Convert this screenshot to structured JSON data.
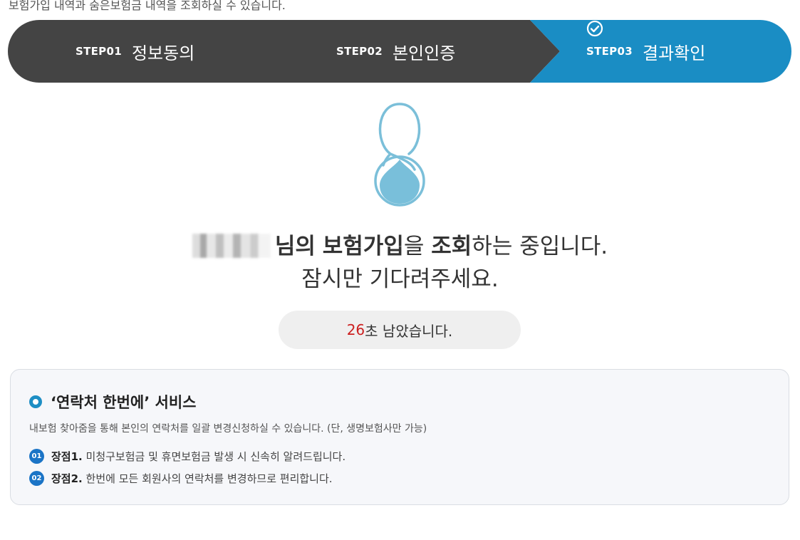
{
  "header": {
    "description": "보험가입 내역과 숨은보험금 내역을 조회하실 수 있습니다."
  },
  "steps": [
    {
      "num": "STEP01",
      "name": "정보동의",
      "active": false
    },
    {
      "num": "STEP02",
      "name": "본인인증",
      "active": false
    },
    {
      "num": "STEP03",
      "name": "결과확인",
      "active": true
    }
  ],
  "colors": {
    "step_inactive": "#444444",
    "step_active": "#1a8dc4",
    "accent_red": "#cc1f1f",
    "badge_blue": "#1b74c6"
  },
  "status": {
    "name_suffix": "님의",
    "bold_insurance": "보험가입",
    "particle_eul": "을",
    "bold_inquiry": "조회",
    "tail": "하는 중입니다.",
    "wait": "잠시만 기다려주세요."
  },
  "timer": {
    "seconds": "26",
    "suffix": "초 남았습니다."
  },
  "service": {
    "title": "‘연락처 한번에’ 서비스",
    "description": "내보험 찾아줌을 통해 본인의 연락처를 일괄 변경신청하실 수 있습니다. (단, 생명보험사만 가능)",
    "benefits": [
      {
        "num": "01",
        "label": "장점1.",
        "text": "미청구보험금 및 휴면보험금 발생 시 신속히 알려드립니다."
      },
      {
        "num": "02",
        "label": "장점2.",
        "text": "한번에 모든 회원사의 연락처를 변경하므로 편리합니다."
      }
    ]
  }
}
